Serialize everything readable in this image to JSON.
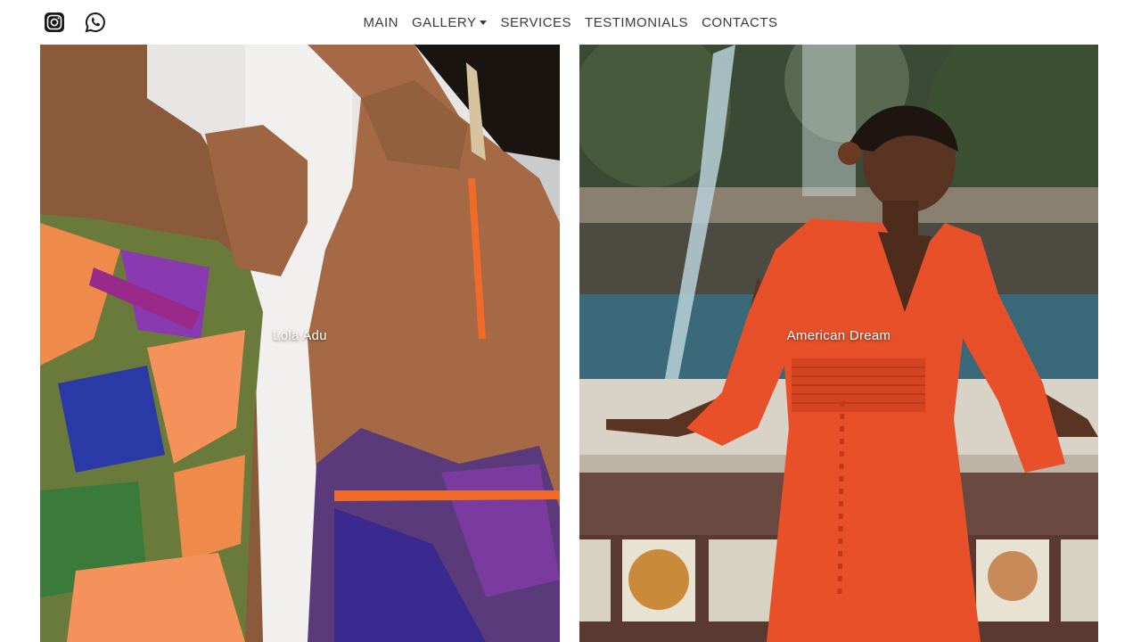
{
  "header": {
    "social": [
      {
        "icon": "instagram-icon"
      },
      {
        "icon": "whatsapp-icon"
      }
    ],
    "nav": [
      {
        "label": "MAIN"
      },
      {
        "label": "GALLERY"
      },
      {
        "label": "SERVICES"
      },
      {
        "label": "TESTIMONIALS"
      },
      {
        "label": "CONTACTS"
      }
    ]
  },
  "gallery": {
    "items": [
      {
        "caption": "Lola Adu"
      },
      {
        "caption": "American Dream"
      }
    ]
  },
  "colors": {
    "nav_text": "#3a3a3a",
    "caption_text": "#ffffff",
    "dress_orange": "#e8502a"
  }
}
